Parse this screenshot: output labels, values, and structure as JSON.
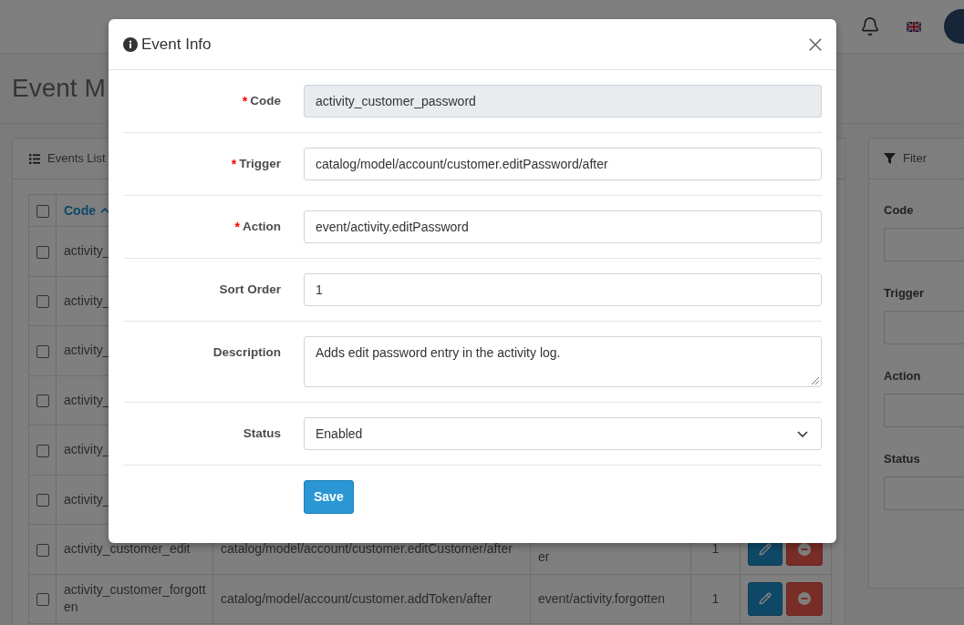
{
  "page": {
    "title": "Event M"
  },
  "events_list": {
    "title": "Events List",
    "select_all": {
      "checked": false
    },
    "columns": [
      {
        "label": "Code",
        "sorted": true
      }
    ],
    "rows": [
      {
        "checked": false,
        "code": "activity_"
      },
      {
        "checked": false,
        "code": "activity_"
      },
      {
        "checked": false,
        "code": "activity_"
      },
      {
        "checked": false,
        "code": "activity_"
      },
      {
        "checked": false,
        "code": "activity_"
      },
      {
        "checked": false,
        "code": "activity_"
      },
      {
        "checked": false,
        "code": "activity_customer_edit",
        "trigger": "catalog/model/account/customer.editCustomer/after",
        "action": "er",
        "sort_order": "1"
      },
      {
        "checked": false,
        "code": "activity_customer_forgotten",
        "trigger": "catalog/model/account/customer.addToken/after",
        "action": "event/activity.forgotten",
        "sort_order": "1"
      }
    ]
  },
  "filter": {
    "title": "Fiter",
    "fields": [
      {
        "label": "Code"
      },
      {
        "label": "Trigger"
      },
      {
        "label": "Action"
      },
      {
        "label": "Status"
      }
    ]
  },
  "modal": {
    "title": "Event Info",
    "fields": [
      {
        "kind": "text",
        "label": "Code",
        "required_mark": "*",
        "readonly": true,
        "value": "activity_customer_password"
      },
      {
        "kind": "text",
        "label": "Trigger",
        "required_mark": "*",
        "readonly": false,
        "value": "catalog/model/account/customer.editPassword/after"
      },
      {
        "kind": "text",
        "label": "Action",
        "required_mark": "*",
        "readonly": false,
        "value": "event/activity.editPassword"
      },
      {
        "kind": "text",
        "label": "Sort Order",
        "readonly": false,
        "value": "1"
      },
      {
        "kind": "textarea",
        "label": "Description",
        "readonly": false,
        "value": "Adds edit password entry in the activity log."
      },
      {
        "kind": "select",
        "label": "Status",
        "readonly": false,
        "value": "Enabled"
      }
    ],
    "save_button": "Save"
  }
}
